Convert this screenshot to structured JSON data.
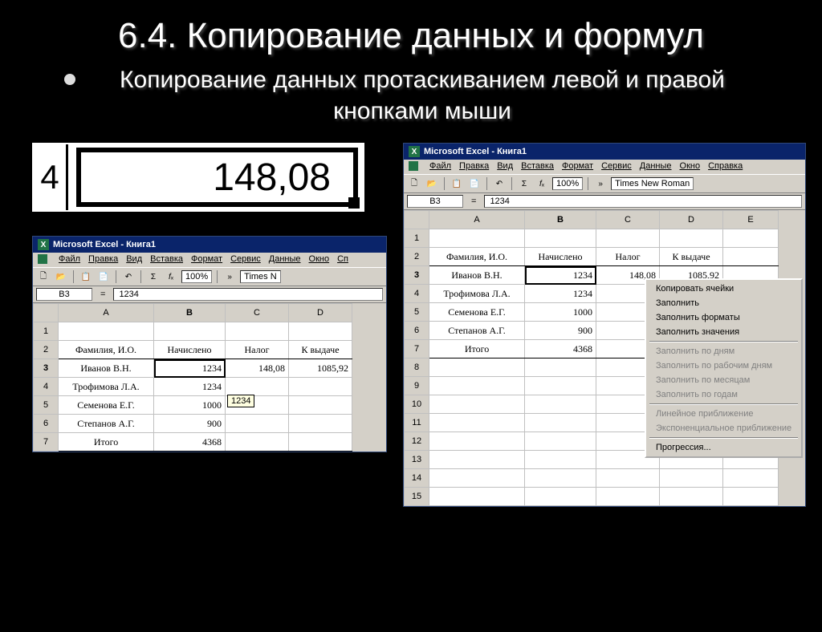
{
  "slide": {
    "title": "6.4. Копирование данных и формул",
    "subtitle": "Копирование данных протаскиванием левой и правой кнопками мыши"
  },
  "zoom": {
    "row": "4",
    "value": "148,08"
  },
  "excel": {
    "title": "Microsoft Excel - Книга1",
    "menu": [
      "Файл",
      "Правка",
      "Вид",
      "Вставка",
      "Формат",
      "Сервис",
      "Данные",
      "Окно",
      "Справка"
    ],
    "zoom": "100%",
    "font": "Times New Roman",
    "name_box": "B3",
    "formula": "1234",
    "cols": [
      "A",
      "B",
      "C",
      "D",
      "E"
    ],
    "rows": [
      {
        "n": "1"
      },
      {
        "n": "2",
        "a": "Фамилия, И.О.",
        "b": "Начислено",
        "c": "Налог",
        "d": "К выдаче"
      },
      {
        "n": "3",
        "a": "Иванов В.Н.",
        "b": "1234",
        "c": "148,08",
        "d": "1085,92"
      },
      {
        "n": "4",
        "a": "Трофимова Л.А.",
        "b": "1234"
      },
      {
        "n": "5",
        "a": "Семенова Е.Г.",
        "b": "1000"
      },
      {
        "n": "6",
        "a": "Степанов А.Г.",
        "b": "900"
      },
      {
        "n": "7",
        "a": "Итого",
        "b": "4368"
      },
      {
        "n": "8"
      },
      {
        "n": "9"
      },
      {
        "n": "10"
      },
      {
        "n": "11"
      },
      {
        "n": "12"
      },
      {
        "n": "13"
      },
      {
        "n": "14"
      },
      {
        "n": "15"
      }
    ],
    "drag_tip": "1234",
    "context_menu": {
      "items": [
        {
          "label": "Копировать ячейки",
          "enabled": true
        },
        {
          "label": "Заполнить",
          "enabled": true
        },
        {
          "label": "Заполнить форматы",
          "enabled": true
        },
        {
          "label": "Заполнить значения",
          "enabled": true
        }
      ],
      "items2": [
        {
          "label": "Заполнить по дням",
          "enabled": false
        },
        {
          "label": "Заполнить по рабочим дням",
          "enabled": false
        },
        {
          "label": "Заполнить по месяцам",
          "enabled": false
        },
        {
          "label": "Заполнить по годам",
          "enabled": false
        }
      ],
      "items3": [
        {
          "label": "Линейное приближение",
          "enabled": false
        },
        {
          "label": "Экспоненциальное приближение",
          "enabled": false
        }
      ],
      "items4": [
        {
          "label": "Прогрессия...",
          "enabled": true
        }
      ]
    }
  }
}
